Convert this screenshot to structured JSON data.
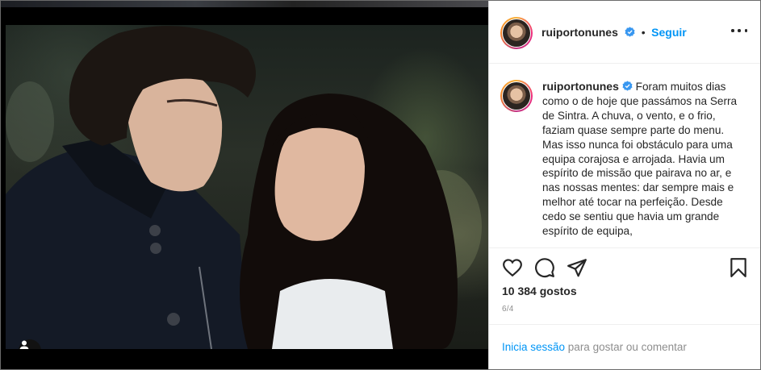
{
  "post": {
    "username": "ruiportonunes",
    "follow_label": "Seguir",
    "separator": "•",
    "caption": "Foram muitos dias como o de hoje que passámos na Serra de Sintra. A chuva, o vento, e o frio, faziam quase sempre parte do menu. Mas isso nunca foi obstáculo para uma equipa corajosa e arrojada. Havia um espírito de missão que pairava no ar, e nas nossas mentes: dar sempre mais e melhor até tocar na perfeição. Desde cedo se sentiu que havia um grande espírito de equipa,",
    "likes_text": "10 384 gostos",
    "date_text": "6/4"
  },
  "footer": {
    "login_link": "Inicia sessão",
    "login_rest": " para gostar ou comentar"
  },
  "icons": {
    "like": "heart-icon",
    "comment": "comment-icon",
    "share": "share-icon",
    "save": "bookmark-icon",
    "more": "more-options-icon",
    "verified": "verified-badge-icon",
    "tags": "user-tag-icon"
  },
  "colors": {
    "link": "#0095f6",
    "text": "#262626",
    "muted": "#8e8e8e",
    "verified": "#3897f0"
  }
}
